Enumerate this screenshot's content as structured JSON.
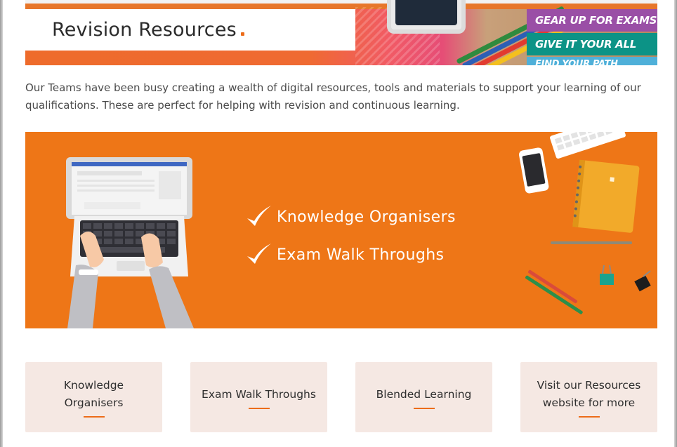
{
  "header": {
    "title": "Revision Resources",
    "tags": [
      "GEAR UP FOR EXAMS",
      "GIVE IT YOUR ALL",
      "FIND YOUR PATH"
    ]
  },
  "intro": {
    "text": "Our Teams have been busy creating a wealth of digital resources, tools and materials to support your learning of our qualifications. These are perfect for helping with revision and continuous learning."
  },
  "promo": {
    "items": [
      "Knowledge Organisers",
      "Exam Walk Throughs"
    ]
  },
  "cards": [
    {
      "label": "Knowledge\nOrganisers"
    },
    {
      "label": "Exam Walk Throughs"
    },
    {
      "label": "Blended Learning"
    },
    {
      "label": "Visit our Resources\nwebsite for more"
    }
  ],
  "colors": {
    "accent": "#ec6c19",
    "banner": "#ee7617",
    "card_bg": "#f5e8e3"
  }
}
